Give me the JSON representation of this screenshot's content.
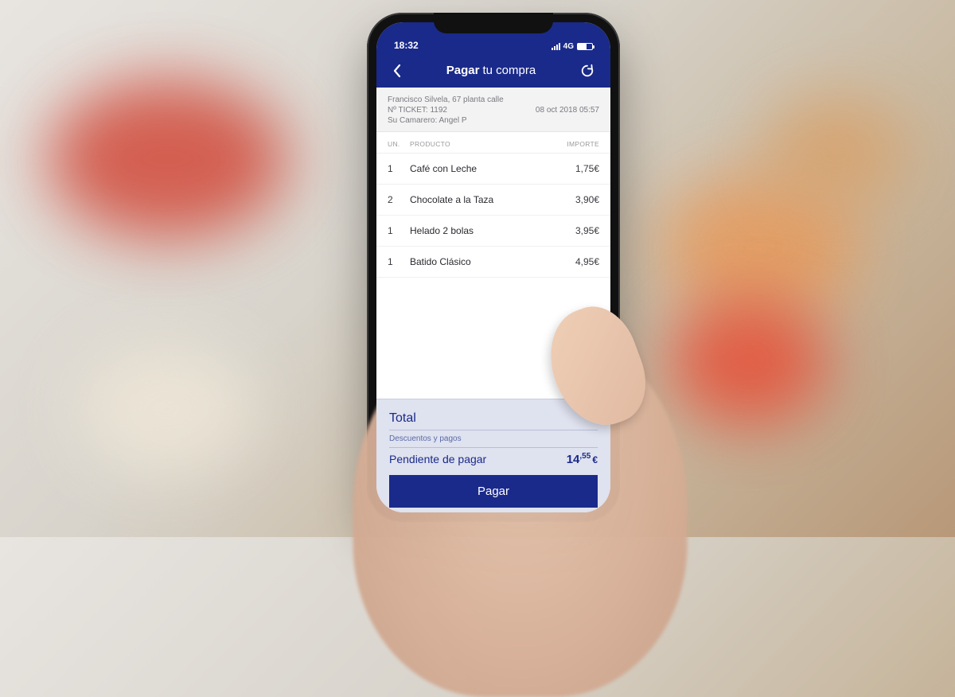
{
  "status": {
    "time": "18:32",
    "signal_label": "4G"
  },
  "header": {
    "title_bold": "Pagar",
    "title_light": "tu compra"
  },
  "ticket": {
    "address": "Francisco Silvela, 67 planta calle",
    "ticket_label": "Nº TICKET: 1192",
    "datetime": "08 oct 2018   05:57",
    "waiter": "Su Camarero: Angel P"
  },
  "columns": {
    "un": "UN.",
    "producto": "PRODUCTO",
    "importe": "IMPORTE"
  },
  "items": [
    {
      "qty": "1",
      "name": "Café con Leche",
      "price": "1,75€"
    },
    {
      "qty": "2",
      "name": "Chocolate a la Taza",
      "price": "3,90€"
    },
    {
      "qty": "1",
      "name": "Helado 2 bolas",
      "price": "3,95€"
    },
    {
      "qty": "1",
      "name": "Batido Clásico",
      "price": "4,95€"
    }
  ],
  "summary": {
    "total_label": "Total",
    "discounts_label": "Descuentos y pagos",
    "pending_label": "Pendiente de pagar",
    "pending_int": "14",
    "pending_dec": ",55",
    "currency": "€"
  },
  "actions": {
    "pay_label": "Pagar"
  }
}
